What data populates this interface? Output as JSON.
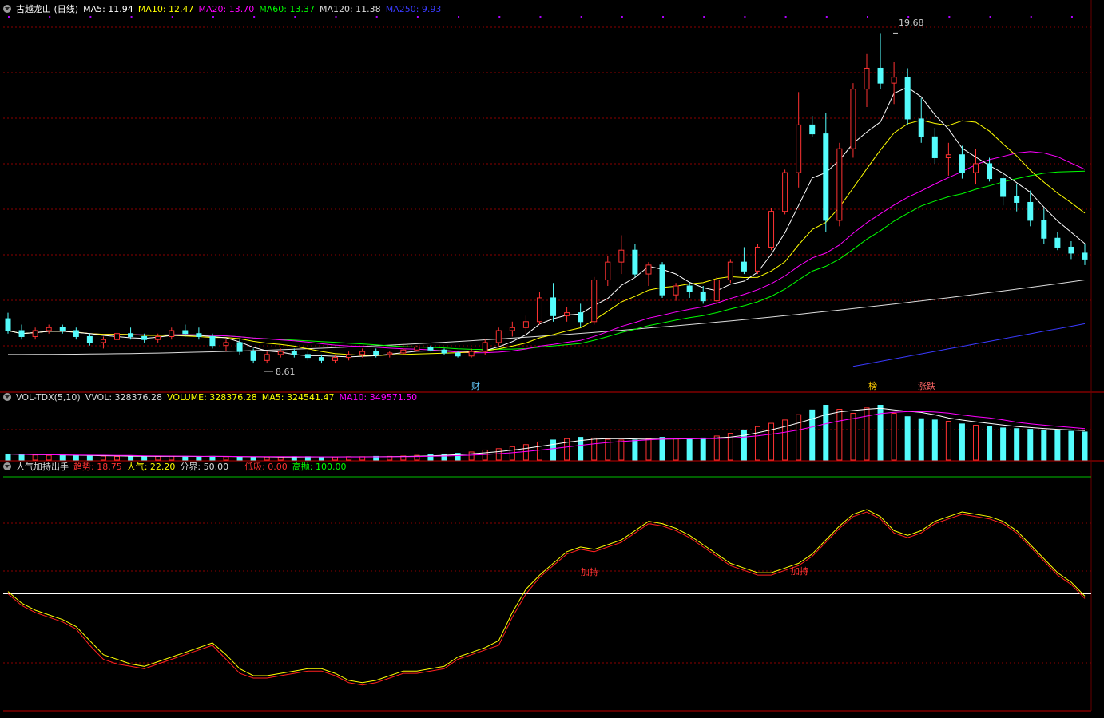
{
  "main": {
    "title": "古越龙山 (日线)",
    "ma_legend": [
      {
        "label": "MA5: 11.94",
        "color": "#ffffff"
      },
      {
        "label": "MA10: 12.47",
        "color": "#ffff00"
      },
      {
        "label": "MA20: 13.70",
        "color": "#ff00ff"
      },
      {
        "label": "MA60: 13.37",
        "color": "#00ff00"
      },
      {
        "label": "MA120: 11.38",
        "color": "#dddddd"
      },
      {
        "label": "MA250: 9.93",
        "color": "#3a3aff"
      }
    ],
    "high_label": "19.68",
    "low_label": "8.61",
    "event_tags": [
      {
        "text": "财",
        "color": "#66ccff"
      },
      {
        "text": "榜",
        "color": "#ffcc00"
      },
      {
        "text": "涨跌",
        "color": "#ff6666"
      }
    ]
  },
  "volume_panel": {
    "indicator": "VOL-TDX(5,10)",
    "vvol": "VVOL: 328376.28",
    "volume": "VOLUME: 328376.28",
    "ma5": "MA5: 324541.47",
    "ma10": "MA10: 349571.50"
  },
  "indicator_panel": {
    "name": "人气加持出手",
    "trend": "趋势: 18.75",
    "popularity": "人气: 22.20",
    "boundary": "分界: 50.00",
    "low_buy": "低吸: 0.00",
    "high_sell": "高抛: 100.00",
    "signal_label": "加持"
  },
  "colors": {
    "up": "#ff3232",
    "down": "#54fcfc",
    "grid": "#8b0000",
    "ma5": "#ffffff",
    "ma10": "#ffff00",
    "ma20": "#ff00ff",
    "ma60": "#00ff00",
    "ma120": "#dddddd",
    "ma250": "#3a3aff"
  },
  "chart_data": [
    {
      "type": "candlestick",
      "title": "古越龙山 (日线)",
      "points": [
        [
          10.1,
          10.3,
          9.6,
          9.7
        ],
        [
          9.7,
          9.9,
          9.4,
          9.5
        ],
        [
          9.5,
          9.8,
          9.4,
          9.7
        ],
        [
          9.7,
          9.9,
          9.6,
          9.8
        ],
        [
          9.8,
          9.9,
          9.6,
          9.7
        ],
        [
          9.7,
          9.8,
          9.4,
          9.5
        ],
        [
          9.5,
          9.6,
          9.2,
          9.3
        ],
        [
          9.3,
          9.5,
          9.1,
          9.4
        ],
        [
          9.4,
          9.7,
          9.3,
          9.6
        ],
        [
          9.6,
          9.8,
          9.4,
          9.5
        ],
        [
          9.5,
          9.6,
          9.3,
          9.4
        ],
        [
          9.4,
          9.6,
          9.3,
          9.5
        ],
        [
          9.5,
          9.8,
          9.4,
          9.7
        ],
        [
          9.7,
          9.9,
          9.5,
          9.6
        ],
        [
          9.6,
          9.8,
          9.4,
          9.5
        ],
        [
          9.5,
          9.6,
          9.1,
          9.2
        ],
        [
          9.2,
          9.4,
          9.0,
          9.3
        ],
        [
          9.3,
          9.4,
          8.9,
          9.0
        ],
        [
          9.0,
          9.1,
          8.6,
          8.7
        ],
        [
          8.7,
          9.0,
          8.6,
          8.9
        ],
        [
          8.9,
          9.1,
          8.8,
          9.0
        ],
        [
          9.0,
          9.1,
          8.8,
          8.9
        ],
        [
          8.9,
          9.0,
          8.7,
          8.8
        ],
        [
          8.8,
          8.9,
          8.6,
          8.7
        ],
        [
          8.7,
          8.9,
          8.6,
          8.8
        ],
        [
          8.8,
          9.0,
          8.7,
          8.9
        ],
        [
          8.9,
          9.1,
          8.8,
          9.0
        ],
        [
          9.0,
          9.1,
          8.8,
          8.9
        ],
        [
          8.9,
          9.0,
          8.8,
          8.95
        ],
        [
          8.95,
          9.1,
          8.9,
          9.05
        ],
        [
          9.05,
          9.2,
          9.0,
          9.15
        ],
        [
          9.15,
          9.2,
          9.0,
          9.05
        ],
        [
          9.05,
          9.1,
          8.9,
          8.95
        ],
        [
          8.95,
          9.0,
          8.8,
          8.85
        ],
        [
          8.85,
          9.1,
          8.8,
          9.0
        ],
        [
          9.0,
          9.4,
          8.9,
          9.3
        ],
        [
          9.3,
          9.8,
          9.2,
          9.7
        ],
        [
          9.7,
          10.0,
          9.5,
          9.8
        ],
        [
          9.8,
          10.2,
          9.6,
          10.0
        ],
        [
          10.0,
          11.0,
          9.9,
          10.8
        ],
        [
          10.8,
          11.3,
          10.0,
          10.2
        ],
        [
          10.2,
          10.5,
          10.0,
          10.3
        ],
        [
          10.3,
          10.6,
          9.8,
          10.0
        ],
        [
          10.0,
          11.5,
          9.9,
          11.4
        ],
        [
          11.4,
          12.2,
          11.2,
          12.0
        ],
        [
          12.0,
          12.9,
          11.6,
          12.4
        ],
        [
          12.4,
          12.6,
          11.5,
          11.6
        ],
        [
          11.6,
          12.0,
          11.2,
          11.9
        ],
        [
          11.9,
          12.0,
          10.8,
          10.9
        ],
        [
          10.9,
          11.3,
          10.7,
          11.2
        ],
        [
          11.2,
          11.3,
          10.8,
          11.0
        ],
        [
          11.0,
          11.2,
          10.6,
          10.7
        ],
        [
          10.7,
          11.5,
          10.6,
          11.4
        ],
        [
          11.4,
          12.1,
          11.3,
          12.0
        ],
        [
          12.0,
          12.5,
          11.6,
          11.7
        ],
        [
          11.7,
          12.6,
          11.6,
          12.5
        ],
        [
          12.5,
          13.8,
          12.4,
          13.7
        ],
        [
          13.7,
          15.1,
          13.6,
          15.0
        ],
        [
          15.0,
          17.7,
          14.5,
          16.6
        ],
        [
          16.6,
          16.9,
          16.2,
          16.3
        ],
        [
          16.3,
          17.0,
          13.0,
          13.4
        ],
        [
          13.4,
          16.0,
          13.2,
          15.8
        ],
        [
          15.8,
          18.0,
          15.5,
          17.8
        ],
        [
          17.8,
          19.0,
          17.2,
          18.5
        ],
        [
          18.5,
          19.68,
          17.8,
          18.0
        ],
        [
          18.0,
          18.7,
          17.3,
          18.2
        ],
        [
          18.2,
          18.5,
          16.6,
          16.8
        ],
        [
          16.8,
          17.5,
          16.0,
          16.2
        ],
        [
          16.2,
          16.5,
          15.3,
          15.5
        ],
        [
          15.5,
          16.0,
          14.9,
          15.6
        ],
        [
          15.6,
          15.9,
          14.8,
          15.0
        ],
        [
          15.0,
          15.8,
          14.6,
          15.3
        ],
        [
          15.3,
          15.5,
          14.7,
          14.8
        ],
        [
          14.8,
          15.0,
          13.9,
          14.2
        ],
        [
          14.2,
          14.6,
          13.7,
          14.0
        ],
        [
          14.0,
          14.4,
          13.2,
          13.4
        ],
        [
          13.4,
          13.8,
          12.6,
          12.8
        ],
        [
          12.8,
          13.0,
          12.4,
          12.5
        ],
        [
          12.5,
          12.7,
          12.1,
          12.3
        ],
        [
          12.3,
          12.6,
          11.9,
          12.1
        ]
      ],
      "ylim": [
        8.2,
        20.2
      ],
      "high": 19.68,
      "low": 8.61,
      "ma_series": [
        {
          "name": "MA5",
          "last": 11.94
        },
        {
          "name": "MA10",
          "last": 12.47
        },
        {
          "name": "MA20",
          "last": 13.7
        },
        {
          "name": "MA60",
          "last": 13.37
        },
        {
          "name": "MA120",
          "last": 11.38
        },
        {
          "name": "MA250",
          "last": 9.93
        }
      ]
    },
    {
      "type": "bar",
      "title": "VOL-TDX(5,10)",
      "values": [
        90,
        80,
        75,
        70,
        70,
        65,
        60,
        60,
        55,
        55,
        50,
        55,
        60,
        55,
        50,
        55,
        50,
        45,
        45,
        45,
        45,
        50,
        50,
        45,
        45,
        50,
        50,
        55,
        55,
        60,
        70,
        80,
        90,
        100,
        120,
        150,
        170,
        200,
        230,
        270,
        300,
        320,
        340,
        330,
        310,
        300,
        300,
        320,
        340,
        320,
        310,
        330,
        360,
        400,
        450,
        500,
        550,
        600,
        680,
        750,
        820,
        760,
        700,
        780,
        820,
        700,
        650,
        620,
        600,
        580,
        540,
        520,
        500,
        480,
        470,
        460,
        450,
        440,
        430,
        420
      ],
      "ma5_last": 324541.47,
      "ma10_last": 349571.5,
      "last_volume": 328376.28
    },
    {
      "type": "line",
      "title": "人气加持出手",
      "series": [
        {
          "name": "趋势",
          "values": [
            50,
            45,
            42,
            40,
            38,
            35,
            28,
            22,
            20,
            19,
            18,
            20,
            22,
            24,
            26,
            28,
            22,
            16,
            14,
            14,
            15,
            16,
            17,
            17,
            15,
            12,
            11,
            12,
            14,
            16,
            16,
            17,
            18,
            22,
            24,
            26,
            28,
            40,
            50,
            57,
            62,
            67,
            69,
            68,
            70,
            72,
            76,
            80,
            79,
            77,
            74,
            70,
            66,
            62,
            60,
            58,
            58,
            60,
            62,
            66,
            72,
            78,
            83,
            85,
            82,
            76,
            74,
            76,
            80,
            82,
            84,
            83,
            82,
            80,
            76,
            70,
            64,
            58,
            54,
            48
          ]
        },
        {
          "name": "人气",
          "values": [
            51,
            46,
            43,
            41,
            39,
            36,
            30,
            24,
            22,
            20,
            19,
            21,
            23,
            25,
            27,
            29,
            24,
            18,
            15,
            15,
            16,
            17,
            18,
            18,
            16,
            13,
            12,
            13,
            15,
            17,
            17,
            18,
            19,
            23,
            25,
            27,
            30,
            42,
            52,
            58,
            63,
            68,
            70,
            69,
            71,
            73,
            77,
            81,
            80,
            78,
            75,
            71,
            67,
            63,
            61,
            59,
            59,
            61,
            63,
            67,
            73,
            79,
            84,
            86,
            83,
            77,
            75,
            77,
            81,
            83,
            85,
            84,
            83,
            81,
            77,
            71,
            65,
            59,
            55,
            49
          ]
        }
      ],
      "reference_lines": [
        0,
        50,
        100
      ],
      "last": {
        "趋势": 18.75,
        "人气": 22.2,
        "分界": 50.0
      }
    }
  ]
}
